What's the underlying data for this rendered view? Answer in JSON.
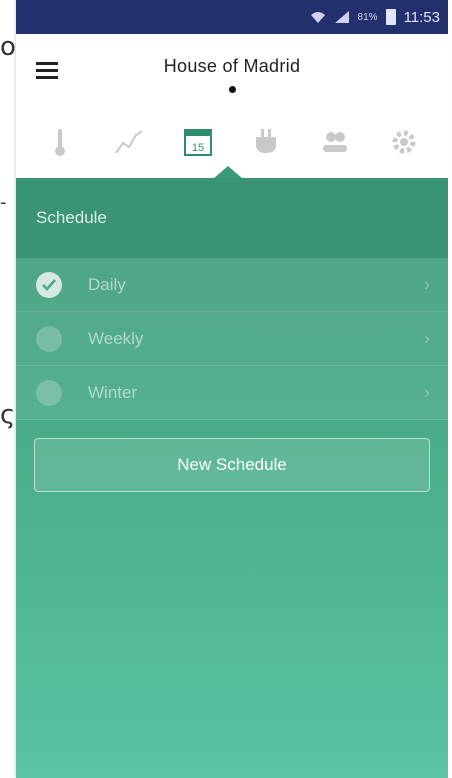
{
  "status_bar": {
    "battery_percent": "81%",
    "time": "11:53"
  },
  "header": {
    "title": "House of Madrid"
  },
  "tabs": [
    {
      "name": "thermometer-icon"
    },
    {
      "name": "chart-icon"
    },
    {
      "name": "calendar-icon",
      "label": "15",
      "active": true
    },
    {
      "name": "plug-icon"
    },
    {
      "name": "users-icon"
    },
    {
      "name": "gear-icon"
    }
  ],
  "section": {
    "title": "Schedule"
  },
  "schedules": [
    {
      "label": "Daily",
      "checked": true
    },
    {
      "label": "Weekly",
      "checked": false
    },
    {
      "label": "Winter",
      "checked": false
    }
  ],
  "actions": {
    "new_schedule_label": "New Schedule"
  },
  "colors": {
    "status_bar": "#22306e",
    "accent": "#3d9a78",
    "gradient_end": "#5ac3a6"
  }
}
